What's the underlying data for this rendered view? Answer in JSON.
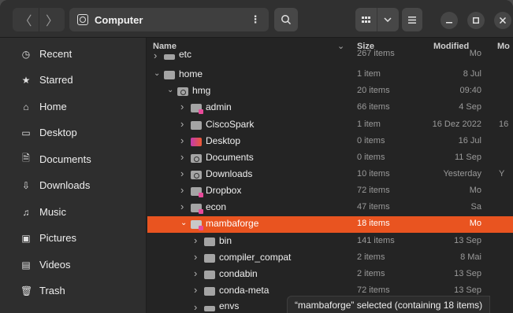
{
  "header": {
    "back_icon": "back-icon",
    "forward_icon": "forward-icon",
    "location": "Computer",
    "location_icon": "computer-icon",
    "menu_glyph": "⋮",
    "search_icon": "search-icon",
    "view_icon": "grid-view-icon",
    "view_dropdown_icon": "chevron-down-icon",
    "hamburger_icon": "hamburger-menu-icon",
    "window_controls": [
      "minimize-icon",
      "maximize-icon",
      "close-icon"
    ]
  },
  "sidebar": {
    "items": [
      {
        "label": "Recent",
        "icon": "clock-icon"
      },
      {
        "label": "Starred",
        "icon": "star-icon"
      },
      {
        "label": "Home",
        "icon": "home-icon"
      },
      {
        "label": "Desktop",
        "icon": "desktop-icon"
      },
      {
        "label": "Documents",
        "icon": "document-icon"
      },
      {
        "label": "Downloads",
        "icon": "download-icon"
      },
      {
        "label": "Music",
        "icon": "music-icon"
      },
      {
        "label": "Pictures",
        "icon": "picture-icon"
      },
      {
        "label": "Videos",
        "icon": "video-icon"
      },
      {
        "label": "Trash",
        "icon": "trash-icon"
      }
    ]
  },
  "columns": {
    "name": "Name",
    "size": "Size",
    "modified": "Modified",
    "modified_extra": "Mo"
  },
  "rows": [
    {
      "name": "etc",
      "size": "267 items",
      "modified": "Mo",
      "expanded": false,
      "depth": 0
    },
    {
      "name": "home",
      "size": "1 item",
      "modified": "8 Jul",
      "expanded": true,
      "depth": 0
    },
    {
      "name": "hmg",
      "size": "20 items",
      "modified": "09:40",
      "expanded": true,
      "depth": 1
    },
    {
      "name": "admin",
      "size": "66 items",
      "modified": "4 Sep",
      "expanded": false,
      "depth": 2
    },
    {
      "name": "CiscoSpark",
      "size": "1 item",
      "modified": "16 Dez 2022",
      "modified_extra": "16",
      "expanded": false,
      "depth": 2
    },
    {
      "name": "Desktop",
      "size": "0 items",
      "modified": "16 Jul",
      "expanded": false,
      "depth": 2
    },
    {
      "name": "Documents",
      "size": "0 items",
      "modified": "11 Sep",
      "expanded": false,
      "depth": 2
    },
    {
      "name": "Downloads",
      "size": "10 items",
      "modified": "Yesterday",
      "modified_extra": "Y",
      "expanded": false,
      "depth": 2
    },
    {
      "name": "Dropbox",
      "size": "72 items",
      "modified": "Mo",
      "expanded": false,
      "depth": 2
    },
    {
      "name": "econ",
      "size": "47 items",
      "modified": "Sa",
      "expanded": false,
      "depth": 2
    },
    {
      "name": "mambaforge",
      "size": "18 items",
      "modified": "Mo",
      "expanded": true,
      "depth": 2,
      "selected": true
    },
    {
      "name": "bin",
      "size": "141 items",
      "modified": "13 Sep",
      "expanded": false,
      "depth": 3
    },
    {
      "name": "compiler_compat",
      "size": "2 items",
      "modified": "8 Mai",
      "expanded": false,
      "depth": 3
    },
    {
      "name": "condabin",
      "size": "2 items",
      "modified": "13 Sep",
      "expanded": false,
      "depth": 3
    },
    {
      "name": "conda-meta",
      "size": "72 items",
      "modified": "13 Sep",
      "expanded": false,
      "depth": 3
    },
    {
      "name": "envs",
      "size": "",
      "modified": "",
      "expanded": false,
      "depth": 3
    }
  ],
  "status": "“mambaforge” selected  (containing 18 items)"
}
